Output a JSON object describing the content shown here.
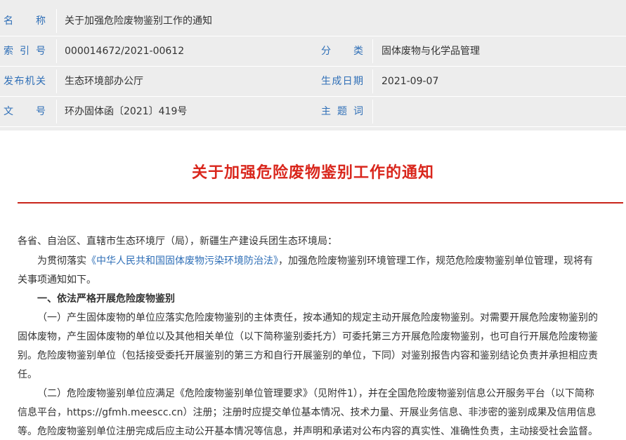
{
  "meta": {
    "rows": [
      {
        "label": "名称",
        "value": "关于加强危险废物鉴别工作的通知"
      },
      {
        "label": "索引号",
        "value": "000014672/2021-00612",
        "label2": "分类",
        "value2": "固体废物与化学品管理"
      },
      {
        "label": "发布机关",
        "value": "生态环境部办公厅",
        "label2": "生成日期",
        "value2": "2021-09-07"
      },
      {
        "label": "文号",
        "value": "环办固体函〔2021〕419号",
        "label2": "主题词",
        "value2": ""
      }
    ]
  },
  "article": {
    "title": "关于加强危险废物鉴别工作的通知",
    "salutation": "各省、自治区、直辖市生态环境厅（局），新疆生产建设兵团生态环境局：",
    "intro_pre": "为贯彻落实",
    "intro_link": "《中华人民共和国固体废物污染环境防治法》",
    "intro_post": "，加强危险废物鉴别环境管理工作，规范危险废物鉴别单位管理，现将有",
    "intro_line2": "关事项通知如下。",
    "section1_heading": "一、依法严格开展危险废物鉴别",
    "p1_line1": "（一）产生固体废物的单位应落实危险废物鉴别的主体责任，按本通知的规定主动开展危险废物鉴别。对需要开展危险废物鉴别的",
    "p1_line2": "固体废物，产生固体废物的单位以及其他相关单位（以下简称鉴别委托方）可委托第三方开展危险废物鉴别，也可自行开展危险废物鉴",
    "p1_line3": "别。危险废物鉴别单位（包括接受委托开展鉴别的第三方和自行开展鉴别的单位，下同）对鉴别报告内容和鉴别结论负责并承担相应责",
    "p1_line4": "任。",
    "p2_line1": "（二）危险废物鉴别单位应满足《危险废物鉴别单位管理要求》（见附件1），并在全国危险废物鉴别信息公开服务平台（以下简称",
    "p2_line2": "信息平台，https://gfmh.meescc.cn）注册；注册时应提交单位基本情况、技术力量、开展业务信息、非涉密的鉴别成果及信用信息",
    "p2_line3": "等。危险废物鉴别单位注册完成后应主动公开基本情况等信息，并声明和承诺对公布内容的真实性、准确性负责，主动接受社会监督。"
  }
}
